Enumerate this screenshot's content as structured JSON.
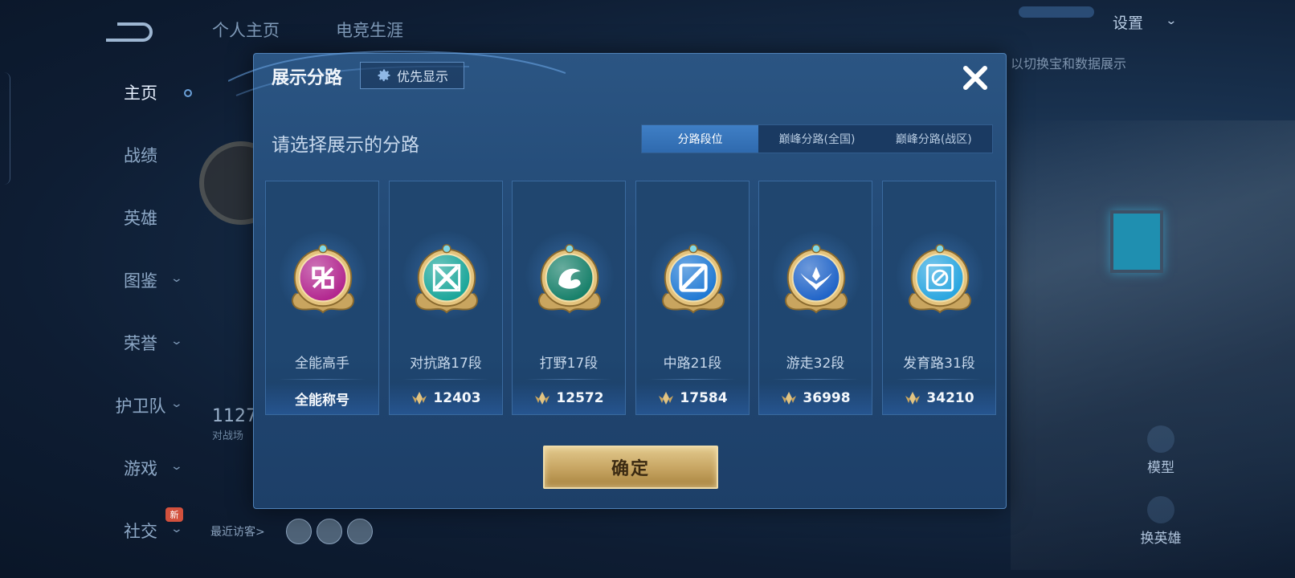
{
  "background": {
    "top_tabs": [
      "个人主页",
      "电竞生涯"
    ],
    "sidebar": [
      {
        "label": "主页",
        "active": true,
        "has_chevron": false
      },
      {
        "label": "战绩",
        "active": false,
        "has_chevron": false
      },
      {
        "label": "英雄",
        "active": false,
        "has_chevron": false
      },
      {
        "label": "图鉴",
        "active": false,
        "has_chevron": true
      },
      {
        "label": "荣誉",
        "active": false,
        "has_chevron": true
      },
      {
        "label": "护卫队",
        "active": false,
        "has_chevron": true
      },
      {
        "label": "游戏",
        "active": false,
        "has_chevron": true
      },
      {
        "label": "社交",
        "active": false,
        "has_chevron": true
      }
    ],
    "new_badge": "新",
    "settings_label": "设置",
    "right_hint": "以切换宝和数据展示",
    "bg_number": "1127",
    "bg_sub": "对战场",
    "recent_visitors_label": "最近访客>",
    "right_actions": [
      "模型",
      "换英雄"
    ]
  },
  "modal": {
    "title": "展示分路",
    "priority_button": "优先显示",
    "instruction": "请选择展示的分路",
    "tabs": [
      {
        "label": "分路段位",
        "active": true
      },
      {
        "label": "巅峰分路(全国)",
        "active": false
      },
      {
        "label": "巅峰分路(战区)",
        "active": false
      }
    ],
    "cards": [
      {
        "name": "全能高手",
        "value": "全能称号",
        "show_points_icon": false,
        "badge_color": "#b2268f",
        "badge_icon": "all-round-icon"
      },
      {
        "name": "对抗路17段",
        "value": "12403",
        "show_points_icon": true,
        "badge_color": "#1aa69a",
        "badge_icon": "clash-lane-icon"
      },
      {
        "name": "打野17段",
        "value": "12572",
        "show_points_icon": true,
        "badge_color": "#17806a",
        "badge_icon": "jungle-icon"
      },
      {
        "name": "中路21段",
        "value": "17584",
        "show_points_icon": true,
        "badge_color": "#1f79d4",
        "badge_icon": "mid-lane-icon"
      },
      {
        "name": "游走32段",
        "value": "36998",
        "show_points_icon": true,
        "badge_color": "#2064c8",
        "badge_icon": "roam-icon"
      },
      {
        "name": "发育路31段",
        "value": "34210",
        "show_points_icon": true,
        "badge_color": "#2aa6e0",
        "badge_icon": "farm-lane-icon"
      }
    ],
    "confirm_button": "确定"
  },
  "colors": {
    "gold": "#d9b36a",
    "modal_bg": "#234a76",
    "active_tab": "#3f7fc6"
  }
}
